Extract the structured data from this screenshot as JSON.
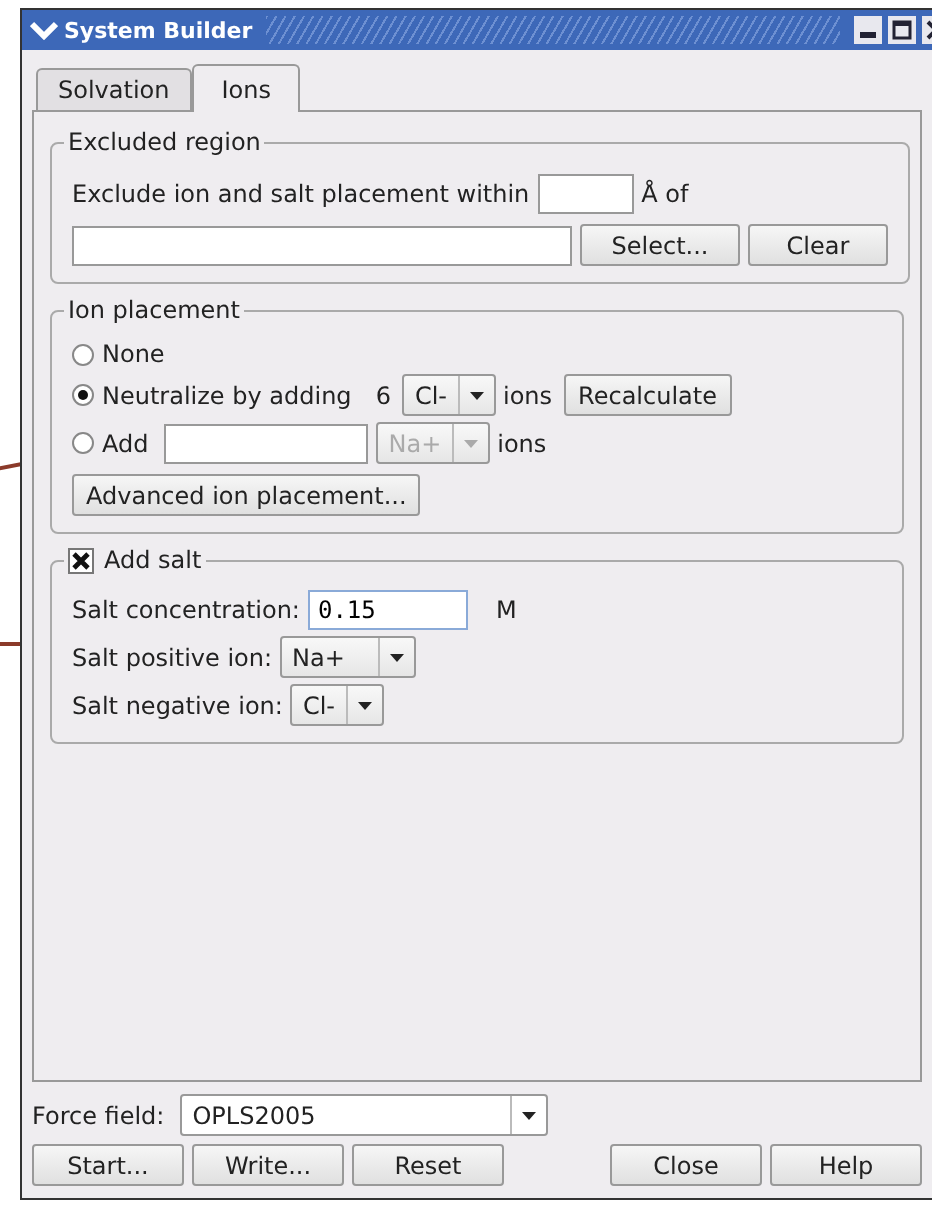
{
  "window": {
    "title": "System Builder"
  },
  "tabs": [
    {
      "label": "Solvation",
      "selected": false
    },
    {
      "label": "Ions",
      "selected": true
    }
  ],
  "excluded_region": {
    "title": "Excluded region",
    "label": "Exclude ion and salt placement within",
    "unit": "Å of",
    "select_button": "Select...",
    "clear_button": "Clear"
  },
  "ion_placement": {
    "title": "Ion placement",
    "options": [
      {
        "kind": "none",
        "label": "None",
        "selected": false
      },
      {
        "kind": "neutralize",
        "label": "Neutralize by adding",
        "count": "6",
        "ion": "Cl-",
        "ion_disabled": false,
        "suffix": "ions",
        "button": "Recalculate",
        "selected": true
      },
      {
        "kind": "add",
        "label": "Add",
        "ion": "Na+",
        "ion_disabled": true,
        "suffix": "ions",
        "selected": false
      }
    ],
    "advanced_button": "Advanced ion placement..."
  },
  "add_salt": {
    "label": "Add salt",
    "checked": true,
    "concentration_label": "Salt concentration:",
    "concentration_value": "0.15",
    "concentration_unit": "M",
    "positive_label": "Salt positive ion:",
    "positive_ion": "Na+",
    "negative_label": "Salt negative ion:",
    "negative_ion": "Cl-"
  },
  "force_field": {
    "label": "Force field:",
    "value": "OPLS2005"
  },
  "footer": {
    "left_buttons": [
      "Start...",
      "Write...",
      "Reset"
    ],
    "right_buttons": [
      "Close",
      "Help"
    ]
  }
}
